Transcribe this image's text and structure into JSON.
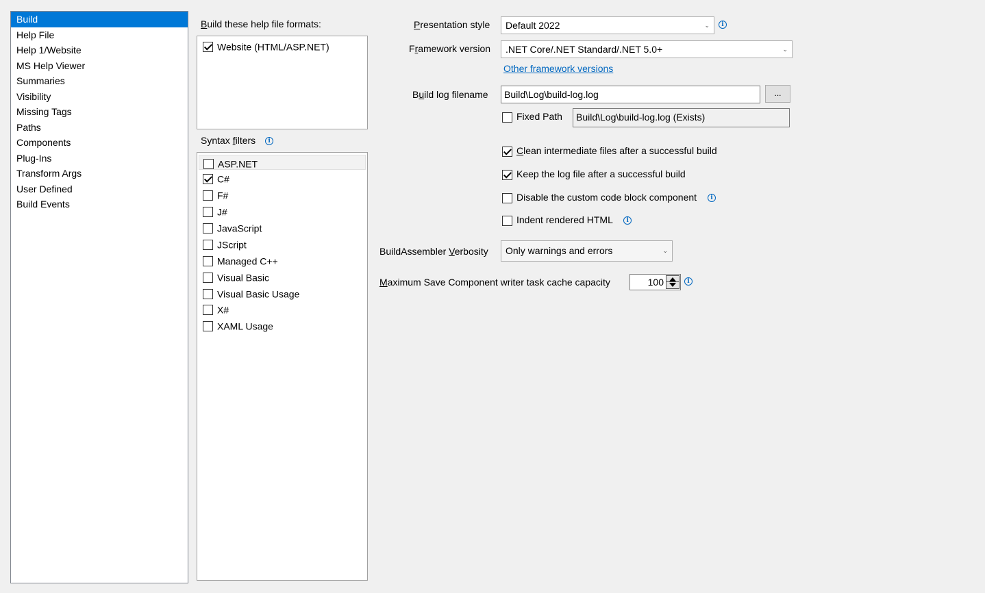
{
  "nav": {
    "items": [
      {
        "label": "Build",
        "selected": true
      },
      {
        "label": "Help File"
      },
      {
        "label": "Help 1/Website"
      },
      {
        "label": "MS Help Viewer"
      },
      {
        "label": "Summaries"
      },
      {
        "label": "Visibility"
      },
      {
        "label": "Missing Tags"
      },
      {
        "label": "Paths"
      },
      {
        "label": "Components"
      },
      {
        "label": "Plug-Ins"
      },
      {
        "label": "Transform Args"
      },
      {
        "label": "User Defined"
      },
      {
        "label": "Build Events"
      }
    ]
  },
  "formats": {
    "label_mnemonic": "B",
    "label_rest": "uild these help file formats:",
    "items": [
      {
        "label": "Website (HTML/ASP.NET)",
        "checked": true
      }
    ]
  },
  "syntax": {
    "label_pre": "Syntax ",
    "label_mnemonic": "f",
    "label_rest": "ilters",
    "items": [
      {
        "label": "ASP.NET",
        "checked": false
      },
      {
        "label": "C#",
        "checked": true
      },
      {
        "label": "F#",
        "checked": false
      },
      {
        "label": "J#",
        "checked": false
      },
      {
        "label": "JavaScript",
        "checked": false
      },
      {
        "label": "JScript",
        "checked": false
      },
      {
        "label": "Managed C++",
        "checked": false
      },
      {
        "label": "Visual Basic",
        "checked": false
      },
      {
        "label": "Visual Basic Usage",
        "checked": false
      },
      {
        "label": "X#",
        "checked": false
      },
      {
        "label": "XAML Usage",
        "checked": false
      }
    ]
  },
  "presentation": {
    "label_mnemonic": "P",
    "label_rest": "resentation style",
    "value": "Default 2022"
  },
  "framework": {
    "label_pre": "F",
    "label_mnemonic": "r",
    "label_rest": "amework version",
    "value": ".NET Core/.NET Standard/.NET 5.0+",
    "link": "Other framework versions"
  },
  "buildlog": {
    "label_pre": "B",
    "label_mnemonic": "u",
    "label_rest": "ild log filename",
    "value": "Build\\Log\\build-log.log",
    "browse_label": "...",
    "fixed_path_label": "Fixed Path",
    "fixed_path_checked": false,
    "resolved": "Build\\Log\\build-log.log (Exists)"
  },
  "options": {
    "clean": {
      "mnemonic": "C",
      "rest": "lean intermediate files after a successful build",
      "checked": true
    },
    "keep": {
      "label": "Keep the log file after a successful build",
      "checked": true
    },
    "disable": {
      "label": "Disable the custom code block component",
      "checked": false
    },
    "indent": {
      "label": "Indent rendered HTML",
      "checked": false
    }
  },
  "verbosity": {
    "label_pre": "BuildAssembler ",
    "label_mnemonic": "V",
    "label_rest": "erbosity",
    "value": "Only warnings and errors"
  },
  "cache": {
    "label_mnemonic": "M",
    "label_rest": "aximum Save Component writer task cache capacity",
    "value": "100"
  },
  "icons": {
    "info": "info-icon",
    "dropdown": "chevron-down-icon",
    "check": "checkmark-icon"
  },
  "colors": {
    "selection": "#0078d7",
    "link": "#0067c0",
    "background": "#f0f0f0"
  }
}
